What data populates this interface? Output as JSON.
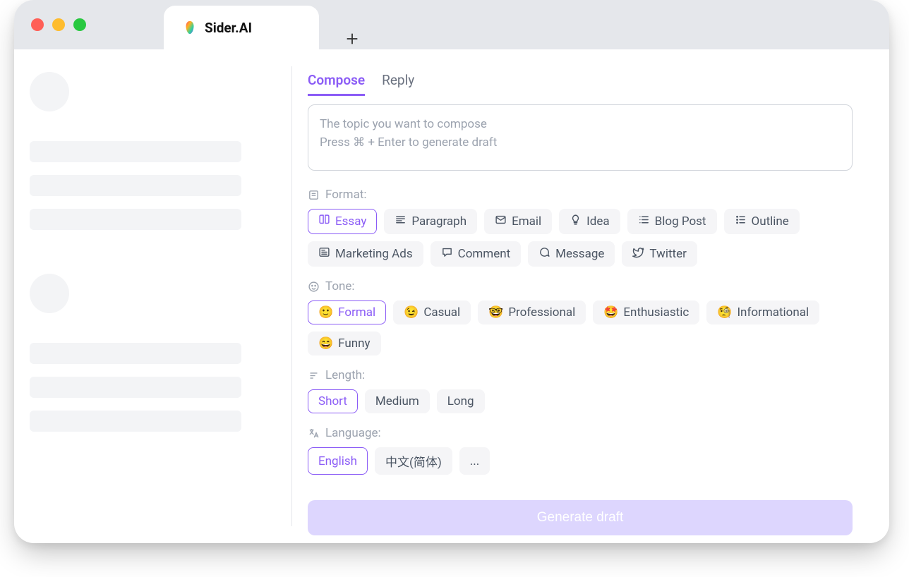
{
  "browser": {
    "tab_title": "Sider.AI"
  },
  "tabs": {
    "compose": "Compose",
    "reply": "Reply",
    "active": "compose"
  },
  "topic": {
    "placeholder_line1": "The topic you want to compose",
    "placeholder_line2": "Press ⌘ + Enter to generate draft"
  },
  "sections": {
    "format_label": "Format:",
    "tone_label": "Tone:",
    "length_label": "Length:",
    "language_label": "Language:"
  },
  "format": {
    "selected": "Essay",
    "options": [
      {
        "label": "Essay",
        "icon": "book"
      },
      {
        "label": "Paragraph",
        "icon": "paragraph"
      },
      {
        "label": "Email",
        "icon": "mail"
      },
      {
        "label": "Idea",
        "icon": "bulb"
      },
      {
        "label": "Blog Post",
        "icon": "list-col"
      },
      {
        "label": "Outline",
        "icon": "list"
      },
      {
        "label": "Marketing Ads",
        "icon": "newspaper"
      },
      {
        "label": "Comment",
        "icon": "comment"
      },
      {
        "label": "Message",
        "icon": "chat"
      },
      {
        "label": "Twitter",
        "icon": "twitter"
      }
    ]
  },
  "tone": {
    "selected": "Formal",
    "options": [
      {
        "label": "Formal",
        "emoji": "🙂"
      },
      {
        "label": "Casual",
        "emoji": "😉"
      },
      {
        "label": "Professional",
        "emoji": "🤓"
      },
      {
        "label": "Enthusiastic",
        "emoji": "🤩"
      },
      {
        "label": "Informational",
        "emoji": "🧐"
      },
      {
        "label": "Funny",
        "emoji": "😄"
      }
    ]
  },
  "length": {
    "selected": "Short",
    "options": [
      "Short",
      "Medium",
      "Long"
    ]
  },
  "language": {
    "selected": "English",
    "options": [
      "English",
      "中文(简体)",
      "..."
    ]
  },
  "generate_label": "Generate draft"
}
